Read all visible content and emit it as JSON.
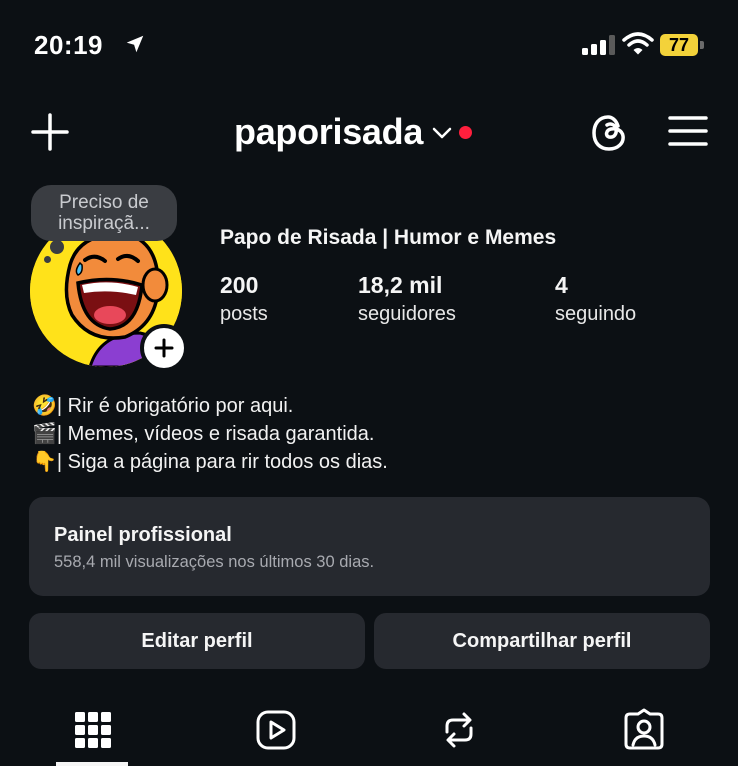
{
  "status_bar": {
    "time": "20:19",
    "battery": "77",
    "icons": [
      "location-arrow-icon",
      "signal-icon",
      "wifi-icon",
      "battery-icon"
    ]
  },
  "header": {
    "username": "paporisada",
    "icons": [
      "plus-icon",
      "chevron-down-icon",
      "threads-icon",
      "menu-icon"
    ],
    "notification_dot_color": "#ff1f3d"
  },
  "profile": {
    "note": "Preciso de inspiraçã...",
    "display_name": "Papo de Risada | Humor e Memes",
    "stats": {
      "posts": {
        "value": "200",
        "label": "posts"
      },
      "followers": {
        "value": "18,2 mil",
        "label": "seguidores"
      },
      "following": {
        "value": "4",
        "label": "seguindo"
      }
    },
    "bio": [
      "🤣| Rir é obrigatório por aqui.",
      "🎬| Memes, vídeos e risada garantida.",
      "👇| Siga a página para rir todos os dias."
    ]
  },
  "dashboard": {
    "title": "Painel profissional",
    "subtitle": "558,4 mil visualizações nos últimos 30 dias."
  },
  "buttons": {
    "edit": "Editar perfil",
    "share": "Compartilhar perfil"
  },
  "tabs": [
    "grid-icon",
    "reels-icon",
    "reposts-icon",
    "tagged-icon"
  ],
  "colors": {
    "background": "#0c1014",
    "card": "#26292f",
    "battery": "#f3d23a"
  }
}
